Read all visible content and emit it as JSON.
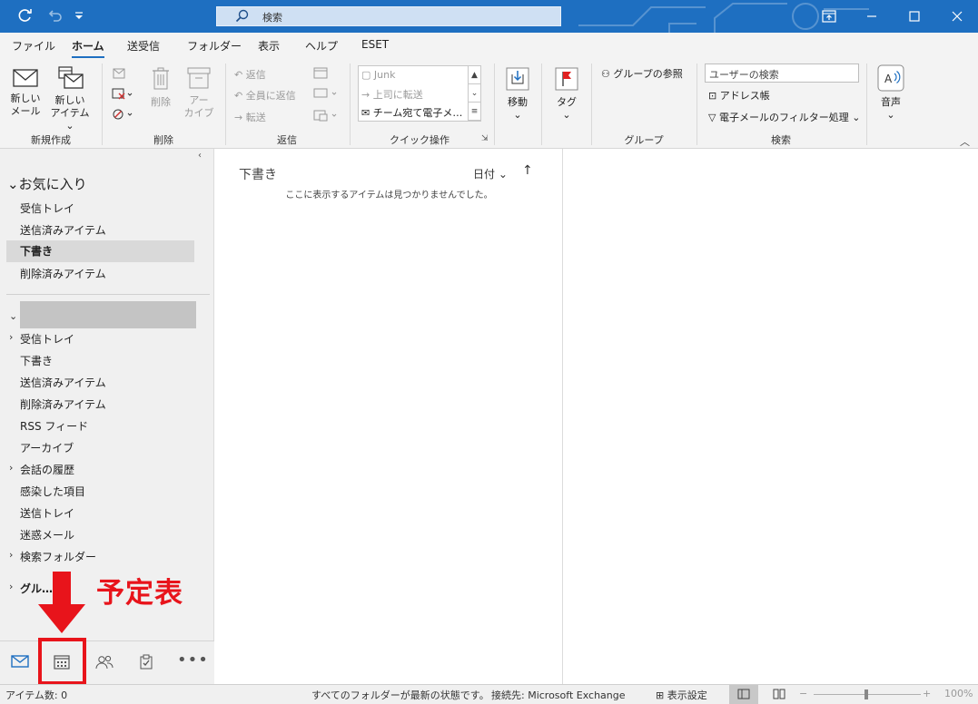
{
  "titlebar": {
    "search_placeholder": "検索",
    "icons": [
      "refresh-icon",
      "undo-icon",
      "customize-icon",
      "search-icon",
      "restore-view-icon",
      "minimize-icon",
      "maximize-icon",
      "close-icon"
    ]
  },
  "menu": {
    "tabs": [
      "ファイル",
      "ホーム",
      "送受信",
      "フォルダー",
      "表示",
      "ヘルプ",
      "ESET"
    ],
    "active": "ホーム"
  },
  "ribbon": {
    "new_group": {
      "label": "新規作成",
      "new_mail_line1": "新しい",
      "new_mail_line2": "メール",
      "new_item_line1": "新しい",
      "new_item_line2": "アイテム"
    },
    "delete_group": {
      "label": "削除",
      "delete": "削除",
      "archive_line1": "アー",
      "archive_line2": "カイブ"
    },
    "respond_group": {
      "label": "返信",
      "reply": "返信",
      "reply_all": "全員に返信",
      "forward": "転送"
    },
    "quicksteps_group": {
      "label": "クイック操作",
      "items": [
        "Junk",
        "上司に転送",
        "チーム宛て電子メ…"
      ]
    },
    "move_group": {
      "move": "移動"
    },
    "tags_group": {
      "tag": "タグ"
    },
    "groups_group": {
      "label": "グループ",
      "browse": "グループの参照"
    },
    "find_group": {
      "label": "検索",
      "user_search_placeholder": "ユーザーの検索",
      "address_book": "アドレス帳",
      "filter_email": "電子メールのフィルター処理"
    },
    "speech_group": {
      "speech": "音声"
    }
  },
  "folderpane": {
    "favorites_header": "お気に入り",
    "favorites": [
      "受信トレイ",
      "送信済みアイテム",
      "下書き",
      "削除済みアイテム"
    ],
    "selected": "下書き",
    "account_folders": [
      {
        "label": "受信トレイ",
        "expandable": true
      },
      {
        "label": "下書き",
        "expandable": false
      },
      {
        "label": "送信済みアイテム",
        "expandable": false
      },
      {
        "label": "削除済みアイテム",
        "expandable": false
      },
      {
        "label": "RSS フィード",
        "expandable": false
      },
      {
        "label": "アーカイブ",
        "expandable": false
      },
      {
        "label": "会話の履歴",
        "expandable": true
      },
      {
        "label": "感染した項目",
        "expandable": false
      },
      {
        "label": "送信トレイ",
        "expandable": false
      },
      {
        "label": "迷惑メール",
        "expandable": false
      },
      {
        "label": "検索フォルダー",
        "expandable": true
      }
    ],
    "groups_header": "グル…"
  },
  "annotation": {
    "text": "予定表",
    "color": "#e8141b"
  },
  "navbar": {
    "icons": [
      "mail-icon",
      "calendar-icon",
      "people-icon",
      "tasks-icon",
      "more-icon"
    ]
  },
  "messagelist": {
    "folder_title": "下書き",
    "sort_label": "日付",
    "empty_message": "ここに表示するアイテムは見つかりませんでした。"
  },
  "statusbar": {
    "item_count": "アイテム数: 0",
    "sync_status": "すべてのフォルダーが最新の状態です。",
    "connection": "接続先: Microsoft Exchange",
    "view_settings": "表示設定",
    "zoom": "100%"
  },
  "colors": {
    "titlebar": "#1e6fc1",
    "accent_red": "#e8141b"
  }
}
